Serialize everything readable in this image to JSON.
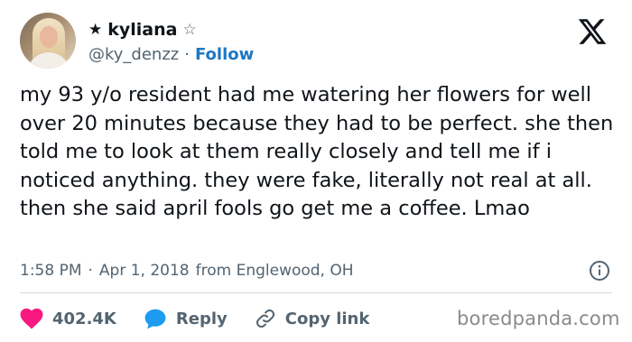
{
  "author": {
    "name": "kyliana",
    "name_prefix_glyph": "★",
    "name_suffix_glyph": "☆",
    "handle": "@ky_denzz",
    "separator": "·",
    "follow_label": "Follow"
  },
  "tweet": {
    "text": "my 93 y/o resident had me watering her flowers for well over 20 minutes because they had to be perfect. she then told me to look at them really closely and tell me if i noticed anything. they were fake, literally not real at all. then she said april fools go get me a coffee. Lmao"
  },
  "meta": {
    "time": "1:58 PM",
    "separator": "·",
    "date": "Apr 1, 2018",
    "source": "from Englewood, OH"
  },
  "actions": {
    "likes": "402.4K",
    "reply_label": "Reply",
    "copy_link_label": "Copy link"
  },
  "watermark": "boredpanda.com",
  "colors": {
    "like": "#f91880",
    "reply": "#1d9bf0",
    "follow": "#1d77c4",
    "secondary_text": "#536471"
  },
  "icons": {
    "logo": "x-logo-icon",
    "info": "info-icon",
    "like": "heart-icon",
    "reply": "speech-bubble-icon",
    "copy_link": "link-icon"
  }
}
